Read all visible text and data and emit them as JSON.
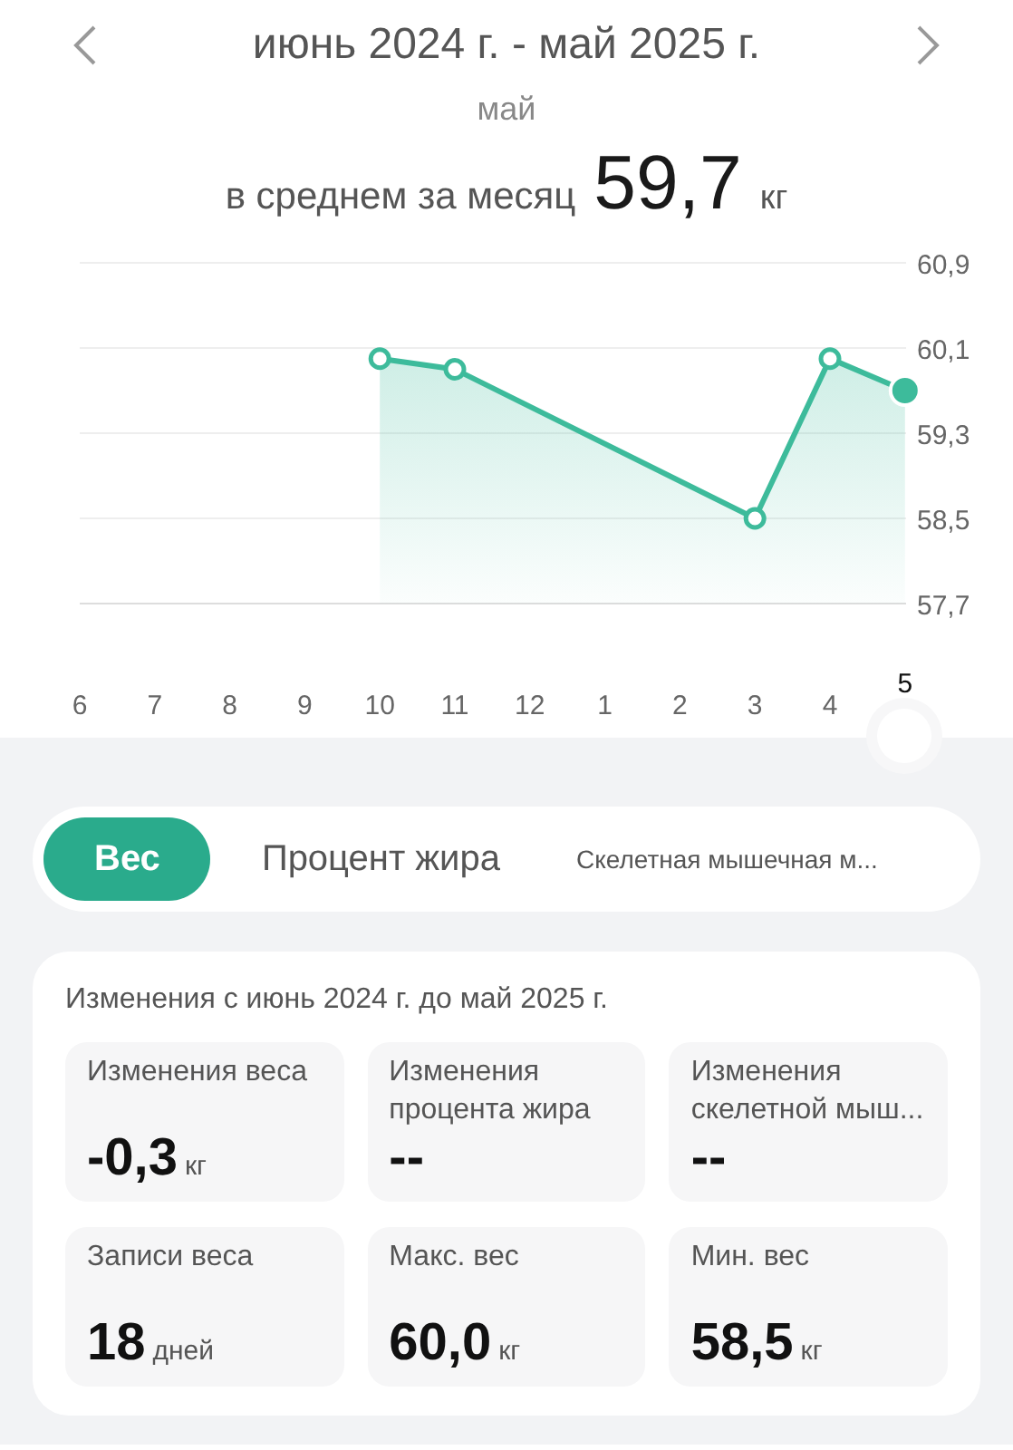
{
  "header": {
    "period": "июнь 2024 г. - май 2025 г.",
    "month": "май",
    "average_label": "в среднем за месяц",
    "average_value": "59,7",
    "average_unit": "кг"
  },
  "chart": {
    "chart_data": {
      "type": "area",
      "categories": [
        "6",
        "7",
        "8",
        "9",
        "10",
        "11",
        "12",
        "1",
        "2",
        "3",
        "4",
        "5"
      ],
      "grid": true,
      "series": [
        {
          "color": "#3dbb9b",
          "values": [
            null,
            null,
            null,
            null,
            60.0,
            59.9,
            null,
            null,
            null,
            58.5,
            60.0,
            59.7
          ]
        }
      ],
      "ylim": [
        57.7,
        60.9
      ],
      "yticks": [
        {
          "value": 60.9,
          "label": "60,9"
        },
        {
          "value": 60.1,
          "label": "60,1"
        },
        {
          "value": 59.3,
          "label": "59,3"
        },
        {
          "value": 58.5,
          "label": "58,5"
        },
        {
          "value": 57.7,
          "label": "57,7"
        }
      ]
    },
    "category_states": [
      {
        "selected": false
      },
      {
        "selected": false
      },
      {
        "selected": false
      },
      {
        "selected": false
      },
      {
        "selected": false
      },
      {
        "selected": false
      },
      {
        "selected": false
      },
      {
        "selected": false
      },
      {
        "selected": false
      },
      {
        "selected": false
      },
      {
        "selected": false
      },
      {
        "selected": true
      }
    ]
  },
  "tabs": [
    {
      "label": "Вес",
      "selected": true,
      "kind": "large"
    },
    {
      "label": "Процент жира",
      "selected": false,
      "kind": "large"
    },
    {
      "label": "Скелетная мышечная м...",
      "selected": false,
      "kind": "small"
    }
  ],
  "changes": {
    "title": "Изменения с июнь 2024 г. до май 2025 г.",
    "cards": [
      {
        "label": "Изменения веса",
        "value": "-0,3",
        "unit": "кг"
      },
      {
        "label": "Изменения процента жира",
        "value": "--"
      },
      {
        "label": "Изменения скелетной мыш...",
        "value": "--"
      },
      {
        "label": "Записи веса",
        "value": "18",
        "unit": "дней"
      },
      {
        "label": "Макс. вес",
        "value": "60,0",
        "unit": "кг"
      },
      {
        "label": "Мин. вес",
        "value": "58,5",
        "unit": "кг"
      }
    ]
  }
}
